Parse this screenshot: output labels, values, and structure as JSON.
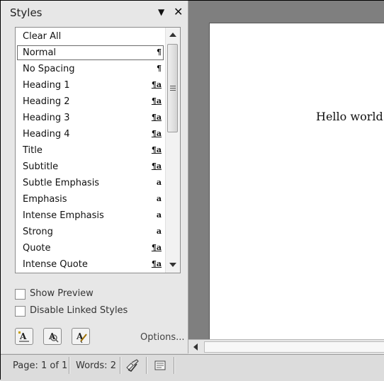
{
  "styles_pane": {
    "title": "Styles",
    "menu_glyph": "▼",
    "close_glyph": "✕",
    "items": [
      {
        "label": "Clear All",
        "glyph": ""
      },
      {
        "label": "Normal",
        "glyph": "¶"
      },
      {
        "label": "No Spacing",
        "glyph": "¶"
      },
      {
        "label": "Heading 1",
        "glyph": "¶a"
      },
      {
        "label": "Heading 2",
        "glyph": "¶a"
      },
      {
        "label": "Heading 3",
        "glyph": "¶a"
      },
      {
        "label": "Heading 4",
        "glyph": "¶a"
      },
      {
        "label": "Title",
        "glyph": "¶a"
      },
      {
        "label": "Subtitle",
        "glyph": "¶a"
      },
      {
        "label": "Subtle Emphasis",
        "glyph": "a"
      },
      {
        "label": "Emphasis",
        "glyph": "a"
      },
      {
        "label": "Intense Emphasis",
        "glyph": "a"
      },
      {
        "label": "Strong",
        "glyph": "a"
      },
      {
        "label": "Quote",
        "glyph": "¶a"
      },
      {
        "label": "Intense Quote",
        "glyph": "¶a"
      }
    ],
    "selected_item": "Normal",
    "show_preview": {
      "label": "Show Preview",
      "checked": false
    },
    "disable_linked": {
      "label": "Disable Linked Styles",
      "checked": false
    },
    "buttons": [
      {
        "name": "new-style-icon",
        "glyph": "A"
      },
      {
        "name": "style-inspector-icon",
        "glyph": "A"
      },
      {
        "name": "manage-styles-icon",
        "glyph": "A"
      }
    ],
    "options_label": "Options..."
  },
  "document": {
    "text": "Hello world!"
  },
  "status_bar": {
    "page": "Page: 1 of 1",
    "words": "Words: 2"
  }
}
